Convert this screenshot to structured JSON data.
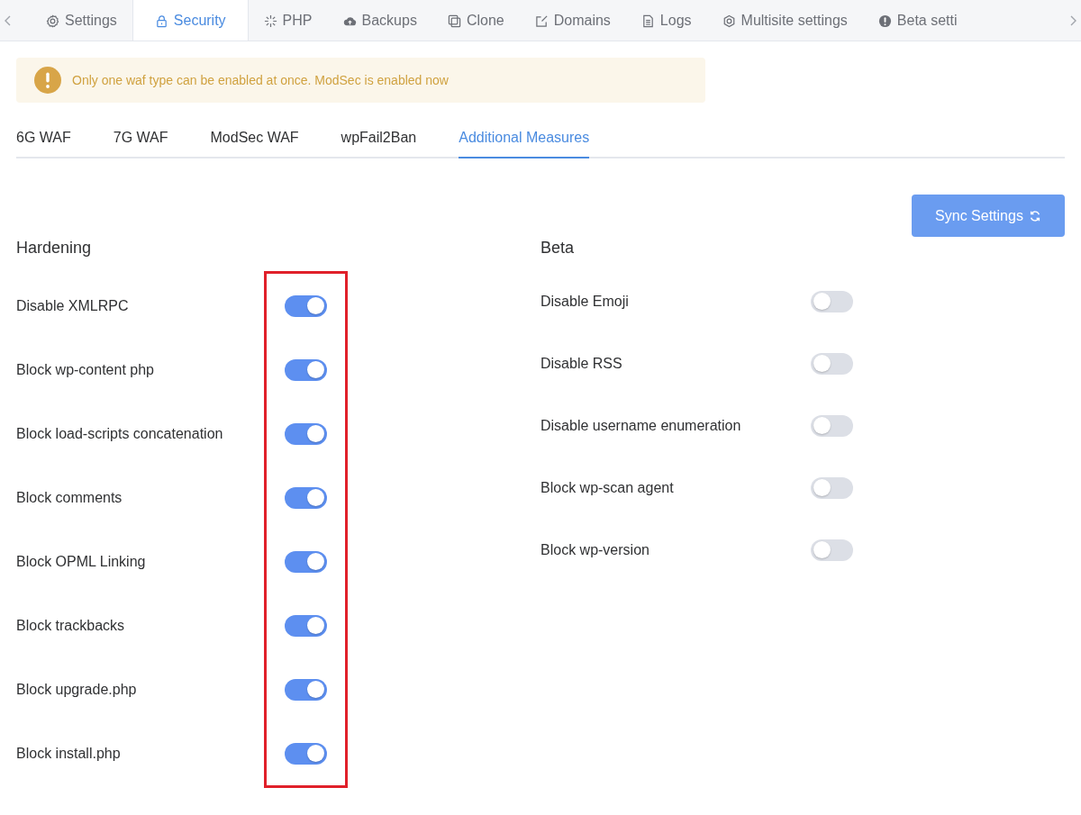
{
  "top_tabs": [
    {
      "label": "Settings",
      "selected": false
    },
    {
      "label": "Security",
      "selected": true
    },
    {
      "label": "PHP",
      "selected": false
    },
    {
      "label": "Backups",
      "selected": false
    },
    {
      "label": "Clone",
      "selected": false
    },
    {
      "label": "Domains",
      "selected": false
    },
    {
      "label": "Logs",
      "selected": false
    },
    {
      "label": "Multisite settings",
      "selected": false
    },
    {
      "label": "Beta setti",
      "selected": false
    }
  ],
  "alert": {
    "message": "Only one waf type can be enabled at once. ModSec is enabled now"
  },
  "sub_tabs": [
    {
      "label": "6G WAF",
      "selected": false
    },
    {
      "label": "7G WAF",
      "selected": false
    },
    {
      "label": "ModSec WAF",
      "selected": false
    },
    {
      "label": "wpFail2Ban",
      "selected": false
    },
    {
      "label": "Additional Measures",
      "selected": true
    }
  ],
  "sync_button": {
    "label": "Sync Settings"
  },
  "hardening": {
    "title": "Hardening",
    "items": [
      {
        "label": "Disable XMLRPC",
        "on": true
      },
      {
        "label": "Block wp-content php",
        "on": true
      },
      {
        "label": "Block load-scripts concatenation",
        "on": true
      },
      {
        "label": "Block comments",
        "on": true
      },
      {
        "label": "Block OPML Linking",
        "on": true
      },
      {
        "label": "Block trackbacks",
        "on": true
      },
      {
        "label": "Block upgrade.php",
        "on": true
      },
      {
        "label": "Block install.php",
        "on": true
      }
    ]
  },
  "beta": {
    "title": "Beta",
    "items": [
      {
        "label": "Disable Emoji",
        "on": false
      },
      {
        "label": "Disable RSS",
        "on": false
      },
      {
        "label": "Disable username enumeration",
        "on": false
      },
      {
        "label": "Block wp-scan agent",
        "on": false
      },
      {
        "label": "Block wp-version",
        "on": false
      }
    ]
  }
}
